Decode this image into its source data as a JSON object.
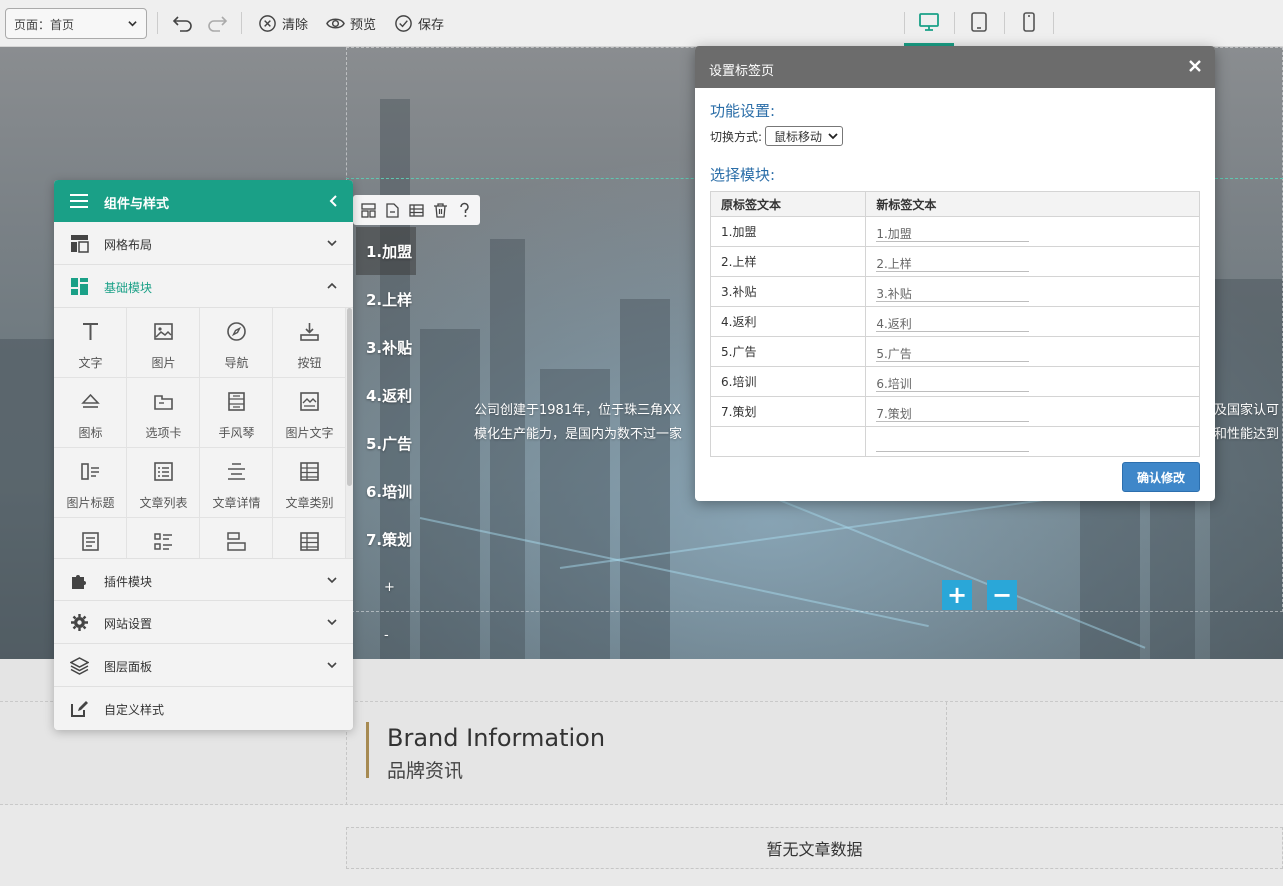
{
  "toolbar": {
    "page_select": "页面：首页",
    "clear_label": "清除",
    "preview_label": "预览",
    "save_label": "保存",
    "active_device": "desktop"
  },
  "hero": {
    "tabs": [
      "1.加盟",
      "2.上样",
      "3.补贴",
      "4.返利",
      "5.广告",
      "6.培训",
      "7.策划"
    ],
    "add_tab": "+",
    "remove_tab": "-",
    "text_line1": "公司创建于1981年，位于珠三角XX",
    "text_line2": "模化生产能力，是国内为数不过一家",
    "text_right1": "及国家认可",
    "text_right2": "和性能达到",
    "plus": "+",
    "minus": "−"
  },
  "panel": {
    "title": "组件与样式",
    "sections": {
      "grid": "网格布局",
      "basic": "基础模块",
      "plugin": "插件模块",
      "site": "网站设置",
      "layers": "图层面板",
      "custom": "自定义样式"
    },
    "components": [
      "文字",
      "图片",
      "导航",
      "按钮",
      "图标",
      "选项卡",
      "手风琴",
      "图片文字",
      "图片标题",
      "文章列表",
      "文章详情",
      "文章类别"
    ]
  },
  "dialog": {
    "title": "设置标签页",
    "function_title": "功能设置:",
    "switch_label": "切换方式:",
    "switch_value": "鼠标移动",
    "module_title": "选择模块:",
    "col_original": "原标签文本",
    "col_new": "新标签文本",
    "rows": [
      {
        "original": "1.加盟",
        "new": "1.加盟"
      },
      {
        "original": "2.上样",
        "new": "2.上样"
      },
      {
        "original": "3.补贴",
        "new": "3.补贴"
      },
      {
        "original": "4.返利",
        "new": "4.返利"
      },
      {
        "original": "5.广告",
        "new": "5.广告"
      },
      {
        "original": "6.培训",
        "new": "6.培训"
      },
      {
        "original": "7.策划",
        "new": "7.策划"
      }
    ],
    "confirm_label": "确认修改"
  },
  "brand": {
    "title_en": "Brand Information",
    "title_cn": "品牌资讯"
  },
  "articles": {
    "empty_text": "暂无文章数据"
  },
  "colors": {
    "accent": "#1aa087",
    "dialog_header": "#6c6c6c",
    "confirm": "#3f87c9",
    "brand_bar": "#a68a52",
    "hero_buttons": "#2aa7d8"
  }
}
